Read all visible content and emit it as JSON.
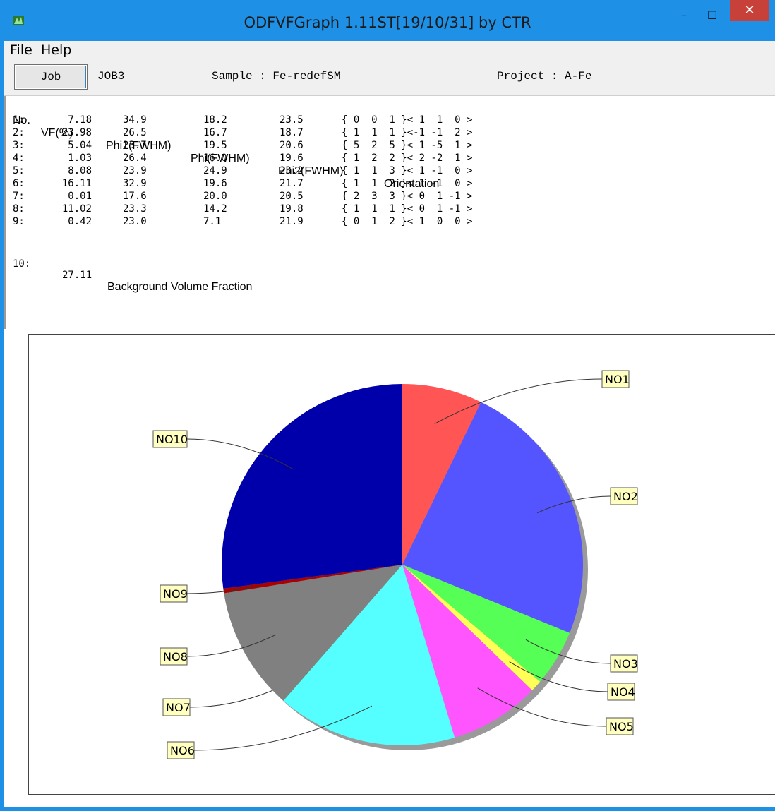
{
  "window": {
    "title": "ODFVFGraph 1.11ST[19/10/31] by CTR",
    "minimize": "–",
    "maximize": "☐",
    "close": "✕"
  },
  "menu": {
    "items": [
      "File",
      "Help"
    ]
  },
  "toolbar": {
    "job_button": "Job",
    "job_name": "JOB3",
    "sample": "Sample : Fe-redefSM",
    "project": "Project : A-Fe"
  },
  "table": {
    "headers": [
      "No.",
      "VF(%)",
      "Phi1(FWHM)",
      "Phi(FWHM)",
      "Phi2(FWHM)",
      "Orientation"
    ],
    "rows": [
      [
        "1:",
        "7.18",
        "34.9",
        "18.2",
        "23.5",
        "{ 0  0  1 }< 1  1  0 >"
      ],
      [
        "2:",
        "23.98",
        "26.5",
        "16.7",
        "18.7",
        "{ 1  1  1 }<-1 -1  2 >"
      ],
      [
        "3:",
        "5.04",
        "23.7",
        "19.5",
        "20.6",
        "{ 5  2  5 }< 1 -5  1 >"
      ],
      [
        "4:",
        "1.03",
        "26.4",
        "16.0",
        "19.6",
        "{ 1  2  2 }< 2 -2  1 >"
      ],
      [
        "5:",
        "8.08",
        "23.9",
        "24.9",
        "23.2",
        "{ 1  1  3 }< 1 -1  0 >"
      ],
      [
        "6:",
        "16.11",
        "32.9",
        "19.6",
        "21.7",
        "{ 1  1  2 }< 1 -1  0 >"
      ],
      [
        "7:",
        "0.01",
        "17.6",
        "20.0",
        "20.5",
        "{ 2  3  3 }< 0  1 -1 >"
      ],
      [
        "8:",
        "11.02",
        "23.3",
        "14.2",
        "19.8",
        "{ 1  1  1 }< 0  1 -1 >"
      ],
      [
        "9:",
        "0.42",
        "23.0",
        "7.1",
        "21.9",
        "{ 0  1  2 }< 1  0  0 >"
      ]
    ],
    "background_row": {
      "no": "10:",
      "vf": "27.11",
      "label": "Background Volume Fraction"
    }
  },
  "chart_data": {
    "type": "pie",
    "start_angle_deg": 0,
    "direction": "clockwise",
    "slices": [
      {
        "label": "NO1",
        "value": 7.18,
        "color": "#ff5555"
      },
      {
        "label": "NO2",
        "value": 23.98,
        "color": "#5555ff"
      },
      {
        "label": "NO3",
        "value": 5.04,
        "color": "#55ff55"
      },
      {
        "label": "NO4",
        "value": 1.03,
        "color": "#ffff55"
      },
      {
        "label": "NO5",
        "value": 8.08,
        "color": "#ff55ff"
      },
      {
        "label": "NO6",
        "value": 16.11,
        "color": "#55ffff"
      },
      {
        "label": "NO7",
        "value": 0.01,
        "color": "#00aa00"
      },
      {
        "label": "NO8",
        "value": 11.02,
        "color": "#808080"
      },
      {
        "label": "NO9",
        "value": 0.42,
        "color": "#aa0000"
      },
      {
        "label": "NO10",
        "value": 27.11,
        "color": "#0000aa"
      }
    ]
  }
}
